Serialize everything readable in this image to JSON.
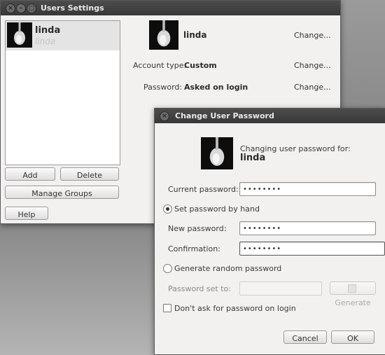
{
  "users_window": {
    "title": "Users Settings",
    "user_list": [
      {
        "name": "linda",
        "subtitle": "linda"
      }
    ],
    "add_label": "Add",
    "delete_label": "Delete",
    "manage_groups_label": "Manage Groups",
    "help_label": "Help",
    "detail": {
      "name": "linda",
      "account_type_label": "Account type:",
      "account_type_value": "Custom",
      "password_label": "Password:",
      "password_value": "Asked on login",
      "change_label": "Change..."
    }
  },
  "password_dialog": {
    "title": "Change User Password",
    "changing_for_label": "Changing user password for:",
    "username": "linda",
    "current_password_label": "Current password:",
    "current_password_value": "••••••••",
    "set_by_hand_label": "Set password by hand",
    "new_password_label": "New password:",
    "new_password_value": "••••••••",
    "confirmation_label": "Confirmation:",
    "confirmation_value": "••••••••",
    "generate_random_label": "Generate random password",
    "password_set_to_label": "Password set to:",
    "password_set_to_value": "",
    "generate_button_label": "Generate",
    "dont_ask_label": "Don't ask for password on login",
    "cancel_label": "Cancel",
    "ok_label": "OK",
    "selected_option": "set_by_hand",
    "dont_ask_checked": false
  }
}
